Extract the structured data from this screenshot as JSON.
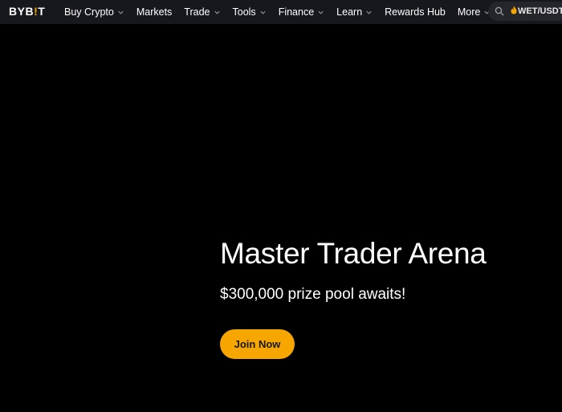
{
  "navbar": {
    "logo_text_before": "BYB",
    "logo_bang": "!",
    "logo_text_after": "T",
    "items": [
      {
        "label": "Buy Crypto",
        "dropdown": true
      },
      {
        "label": "Markets",
        "dropdown": false
      },
      {
        "label": "Trade",
        "dropdown": true
      },
      {
        "label": "Tools",
        "dropdown": true
      },
      {
        "label": "Finance",
        "dropdown": true
      },
      {
        "label": "Learn",
        "dropdown": true
      },
      {
        "label": "Rewards Hub",
        "dropdown": false
      },
      {
        "label": "More",
        "dropdown": true
      }
    ],
    "search": {
      "icon": "search-icon",
      "trending_icon": "fire-icon",
      "text": "WET/USDT"
    }
  },
  "hero": {
    "title": "Master Trader Arena",
    "subtitle": "$300,000 prize pool awaits!",
    "cta_label": "Join Now"
  },
  "colors": {
    "background": "#000000",
    "navbar_bg": "#17181e",
    "accent": "#f7a600",
    "text": "#ffffff"
  }
}
